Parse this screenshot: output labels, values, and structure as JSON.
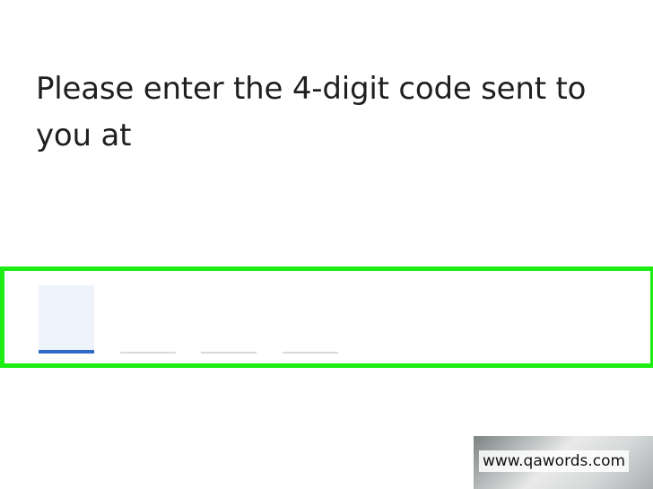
{
  "prompt": {
    "text": "Please enter the 4-digit code sent to you at"
  },
  "code_input": {
    "digits": [
      "",
      "",
      "",
      ""
    ],
    "active_index": 0,
    "highlight_color": "#1ded12",
    "active_color": "#2e6ac8"
  },
  "watermark": {
    "text": "www.qawords.com"
  }
}
